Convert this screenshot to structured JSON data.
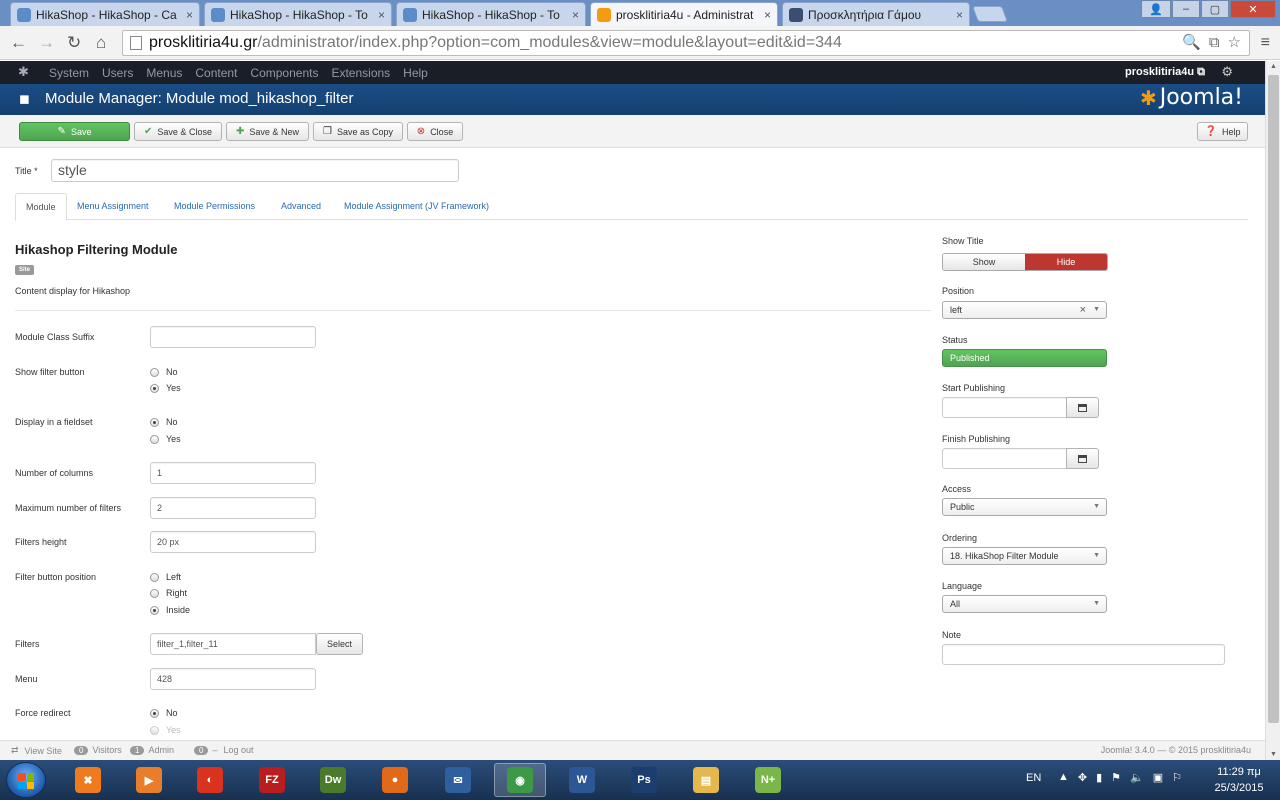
{
  "browser": {
    "tabs": [
      {
        "title": "HikaShop - HikaShop - Ca",
        "active": false,
        "icon_color": "#5b8cc9"
      },
      {
        "title": "HikaShop - HikaShop - To",
        "active": false,
        "icon_color": "#5b8cc9"
      },
      {
        "title": "HikaShop - HikaShop - To",
        "active": false,
        "icon_color": "#5b8cc9"
      },
      {
        "title": "prosklitiria4u - Administrat",
        "active": true,
        "icon_color": "#f39c12"
      },
      {
        "title": "Προσκλητήρια Γάμου",
        "active": false,
        "icon_color": "#3b4e72"
      }
    ],
    "tab_close_glyph": "×",
    "url_host": "prosklitiria4u.gr",
    "url_path": "/administrator/index.php?option=com_modules&view=module&layout=edit&id=344"
  },
  "joomla_nav": {
    "items": [
      "System",
      "Users",
      "Menus",
      "Content",
      "Components",
      "Extensions",
      "Help"
    ],
    "site_name": "prosklitiria4u ⧉"
  },
  "header": {
    "title": "Module Manager: Module mod_hikashop_filter",
    "brand": "Joomla!"
  },
  "toolbar": {
    "save": "Save",
    "save_close": "Save & Close",
    "save_new": "Save & New",
    "save_copy": "Save as Copy",
    "close": "Close",
    "help": "Help"
  },
  "form": {
    "title_label": "Title *",
    "title_value": "style",
    "tabs": [
      "Module",
      "Menu Assignment",
      "Module Permissions",
      "Advanced",
      "Module Assignment (JV Framework)"
    ],
    "module_name": "Hikashop Filtering Module",
    "badge": "Site",
    "description": "Content display for Hikashop",
    "fields": {
      "class_suffix_label": "Module Class Suffix",
      "show_filter_button_label": "Show filter button",
      "show_filter_button_options": [
        "No",
        "Yes"
      ],
      "show_filter_button_selected": "Yes",
      "fieldset_label": "Display in a fieldset",
      "fieldset_options": [
        "No",
        "Yes"
      ],
      "fieldset_selected": "No",
      "columns_label": "Number of columns",
      "columns_value": "1",
      "max_filters_label": "Maximum number of filters",
      "max_filters_value": "2",
      "filters_height_label": "Filters height",
      "filters_height_value": "20 px",
      "button_position_label": "Filter button position",
      "button_position_options": [
        "Left",
        "Right",
        "Inside"
      ],
      "button_position_selected": "Inside",
      "filters_label": "Filters",
      "filters_value": "filter_1,filter_11",
      "select_label": "Select",
      "menu_label": "Menu",
      "menu_value": "428",
      "force_redirect_label": "Force redirect",
      "force_redirect_options": [
        "No",
        "Yes"
      ],
      "force_redirect_selected": "No"
    }
  },
  "sidebar": {
    "show_title_label": "Show Title",
    "show_label": "Show",
    "hide_label": "Hide",
    "position_label": "Position",
    "position_value": "left",
    "status_label": "Status",
    "status_value": "Published",
    "start_label": "Start Publishing",
    "finish_label": "Finish Publishing",
    "access_label": "Access",
    "access_value": "Public",
    "ordering_label": "Ordering",
    "ordering_value": "18. HikaShop Filter Module",
    "language_label": "Language",
    "language_value": "All",
    "note_label": "Note"
  },
  "footer": {
    "view_site": "View Site",
    "visitors_count": "0",
    "visitors": "Visitors",
    "admin_count": "1",
    "admin": "Admin",
    "logout_count": "0",
    "logout": "Log out",
    "version": "Joomla! 3.4.0 — © 2015 prosklitiria4u"
  },
  "taskbar": {
    "lang": "EN",
    "time": "11:29 πμ",
    "date": "25/3/2015",
    "apps": [
      {
        "name": "xampp",
        "label": "✖",
        "color": "#f07b1f",
        "active": false
      },
      {
        "name": "media-player",
        "label": "▶",
        "color": "#e87e2c",
        "active": false
      },
      {
        "name": "filezilla-alt",
        "label": "◐",
        "color": "#d9331f",
        "active": false
      },
      {
        "name": "filezilla",
        "label": "FZ",
        "color": "#b91d1d",
        "active": false
      },
      {
        "name": "dreamweaver",
        "label": "Dw",
        "color": "#4a7a2a",
        "active": false
      },
      {
        "name": "firefox",
        "label": "●",
        "color": "#e06a1a",
        "active": false
      },
      {
        "name": "thunderbird",
        "label": "✉",
        "color": "#2f5f9e",
        "active": false
      },
      {
        "name": "chrome",
        "label": "◉",
        "color": "#3c9a47",
        "active": true
      },
      {
        "name": "word",
        "label": "W",
        "color": "#2b5797",
        "active": false
      },
      {
        "name": "photoshop",
        "label": "Ps",
        "color": "#1b3e6f",
        "active": false
      },
      {
        "name": "explorer",
        "label": "▤",
        "color": "#e4b84c",
        "active": false
      },
      {
        "name": "notepad-plus",
        "label": "N+",
        "color": "#7ab648",
        "active": false
      }
    ]
  },
  "colors": {
    "accent_green": "#51a351",
    "accent_red": "#bd362f",
    "joomla_blue": "#1a4d86",
    "link_blue": "#2a69b8"
  }
}
